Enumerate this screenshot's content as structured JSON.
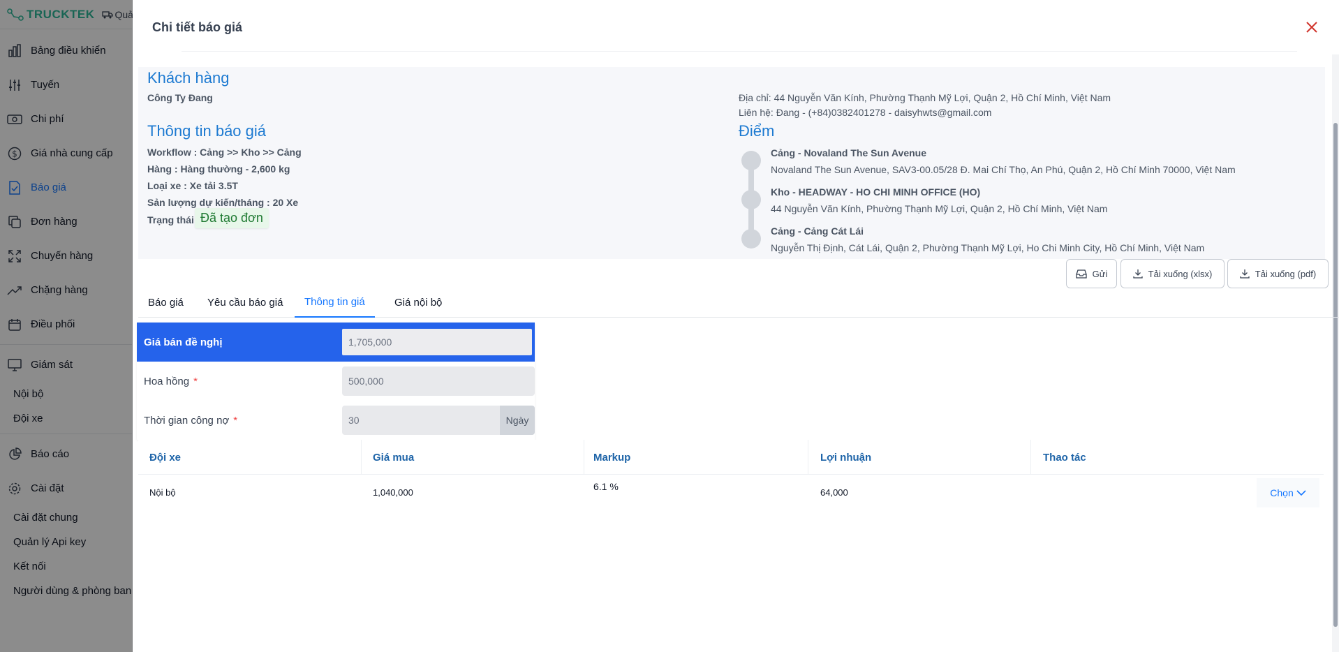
{
  "brand": {
    "name": "TRUCKTEK",
    "top_menu": "Quản"
  },
  "sidebar": {
    "items": [
      {
        "label": "Bảng điều khiển",
        "icon": "bar-chart-icon"
      },
      {
        "label": "Tuyến",
        "icon": "sliders-icon"
      },
      {
        "label": "Chi phí",
        "icon": "money-icon"
      },
      {
        "label": "Giá nhà cung cấp",
        "icon": "dollar-circle-icon"
      },
      {
        "label": "Báo giá",
        "icon": "file-check-icon",
        "active": true
      },
      {
        "label": "Đơn hàng",
        "icon": "copy-icon"
      },
      {
        "label": "Chuyến hàng",
        "icon": "expand-icon"
      },
      {
        "label": "Chặng hàng",
        "icon": "trend-icon"
      },
      {
        "label": "Điều phối",
        "icon": "calendar-icon"
      },
      {
        "label": "Giám sát",
        "icon": "monitor-icon"
      }
    ],
    "monitor_sub": [
      "Nội bộ",
      "Đội xe"
    ],
    "report": {
      "label": "Báo cáo",
      "icon": "pie-chart-icon"
    },
    "settings": {
      "label": "Cài đặt",
      "icon": "gear-icon"
    },
    "settings_sub": [
      "Cài đặt chung",
      "Quản lý Api key",
      "Kết nối",
      "Người dùng & phòng ban"
    ]
  },
  "drawer": {
    "title": "Chi tiết báo giá",
    "customer": {
      "heading": "Khách hàng",
      "name": "Công Ty Đang",
      "address": "Địa chỉ: 44 Nguyễn Văn Kính, Phường Thạnh Mỹ Lợi, Quận 2, Hồ Chí Minh, Việt Nam",
      "contact": "Liên hệ: Đang - (+84)0382401278 - daisyhwts@gmail.com"
    },
    "quote_info": {
      "heading": "Thông tin báo giá",
      "workflow": "Workflow : Cảng >> Kho >> Cảng",
      "goods": "Hàng : Hàng thường - 2,600 kg",
      "vehicle": "Loại xe : Xe tải 3.5T",
      "volume": "Sản lượng dự kiến/tháng : 20 Xe",
      "status_label": "Trạng thái:",
      "status_value": "Đã tạo đơn"
    },
    "points": {
      "heading": "Điểm",
      "list": [
        {
          "name": "Cảng - Novaland The Sun Avenue",
          "address": "Novaland The Sun Avenue, SAV3-00.05/28 Đ. Mai Chí Thọ, An Phú, Quận 2, Hồ Chí Minh 70000, Việt Nam"
        },
        {
          "name": "Kho - HEADWAY - HO CHI MINH OFFICE (HO)",
          "address": "44 Nguyễn Văn Kính, Phường Thạnh Mỹ Lợi, Quận 2, Hồ Chí Minh, Việt Nam"
        },
        {
          "name": "Cảng - Cảng Cát Lái",
          "address": "Nguyễn Thị Định, Cát Lái, Quận 2, Phường Thạnh Mỹ Lợi, Ho Chi Minh City, Hồ Chí Minh, Việt Nam"
        }
      ]
    },
    "actions": {
      "send": "Gửi",
      "download_xlsx": "Tải xuống (xlsx)",
      "download_pdf": "Tải xuống (pdf)"
    },
    "tabs": [
      "Báo giá",
      "Yêu cầu báo giá",
      "Thông tin giá",
      "Giá nội bộ"
    ],
    "active_tab": "Thông tin giá",
    "pricing": {
      "suggested_label": "Giá bán đề nghị",
      "suggested_value": "1,705,000",
      "commission_label": "Hoa hồng",
      "commission_value": "500,000",
      "debt_label": "Thời gian công nợ",
      "debt_value": "30",
      "debt_unit": "Ngày",
      "required_mark": "*"
    },
    "table": {
      "headers": [
        "Đội xe",
        "Giá mua",
        "Markup",
        "Lợi nhuận",
        "Thao tác"
      ],
      "rows": [
        {
          "fleet": "Nội bộ",
          "buy_price": "1,040,000",
          "markup": "6.1 %",
          "profit": "64,000",
          "action": "Chọn"
        }
      ]
    }
  }
}
